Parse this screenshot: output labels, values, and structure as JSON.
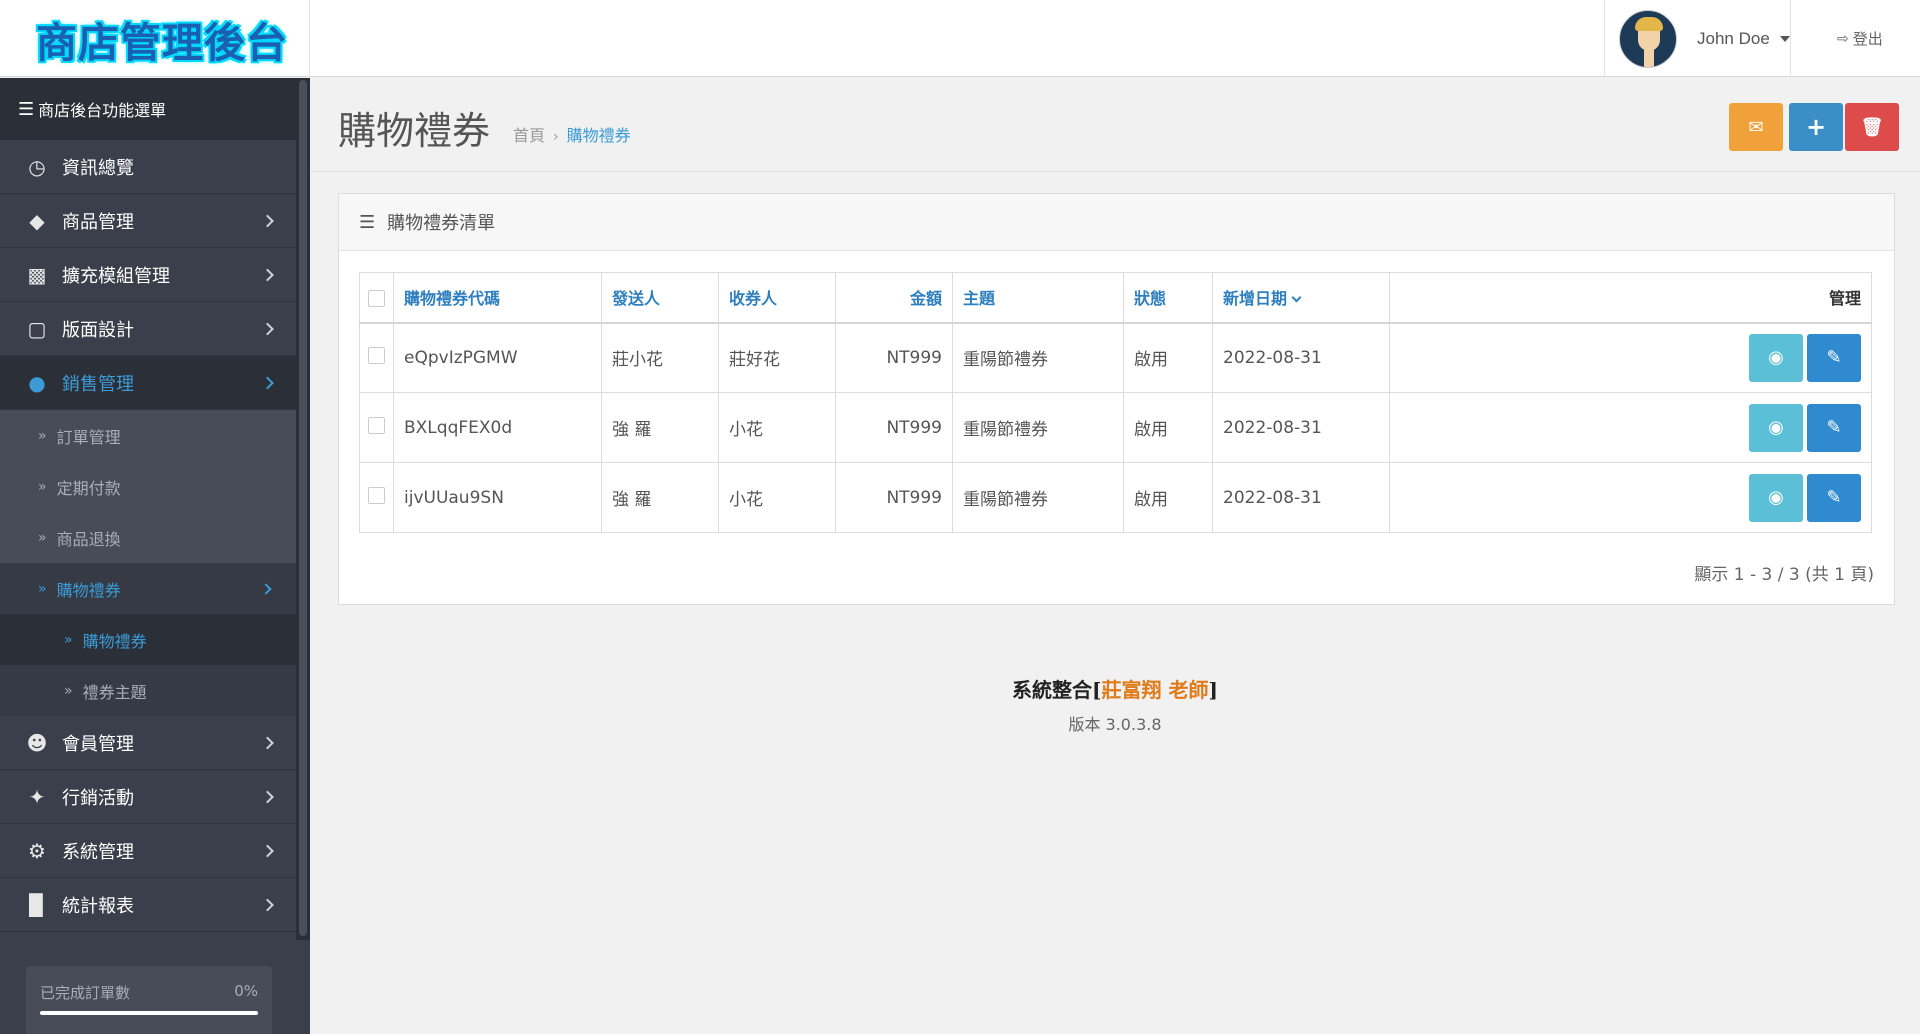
{
  "header": {
    "logo": "商店管理後台",
    "user_name": "John Doe",
    "logout_label": "登出"
  },
  "sidebar": {
    "title": "商店後台功能選單",
    "items": [
      {
        "label": "資訊總覽",
        "icon": "dashboard-icon",
        "has_children": false
      },
      {
        "label": "商品管理",
        "icon": "tags-icon",
        "has_children": true
      },
      {
        "label": "擴充模組管理",
        "icon": "puzzle-icon",
        "has_children": true
      },
      {
        "label": "版面設計",
        "icon": "monitor-icon",
        "has_children": true
      },
      {
        "label": "銷售管理",
        "icon": "cart-icon",
        "has_children": true,
        "active": true
      },
      {
        "label": "會員管理",
        "icon": "user-icon",
        "has_children": true
      },
      {
        "label": "行銷活動",
        "icon": "share-icon",
        "has_children": true
      },
      {
        "label": "系統管理",
        "icon": "gear-icon",
        "has_children": true
      },
      {
        "label": "統計報表",
        "icon": "bar-chart-icon",
        "has_children": true
      }
    ],
    "sales_submenu": [
      {
        "label": "訂單管理"
      },
      {
        "label": "定期付款"
      },
      {
        "label": "商品退換"
      },
      {
        "label": "購物禮券",
        "active": true
      }
    ],
    "coupon_submenu": [
      {
        "label": "購物禮券",
        "active": true
      },
      {
        "label": "禮券主題"
      }
    ],
    "stats": {
      "completed_label": "已完成訂單數",
      "completed_value": "0%",
      "completed_progress": 0
    }
  },
  "page": {
    "title": "購物禮券",
    "breadcrumb": {
      "home": "首頁",
      "current": "購物禮券"
    }
  },
  "panel": {
    "title": "購物禮券清單"
  },
  "table": {
    "columns": {
      "code": "購物禮券代碼",
      "sender": "發送人",
      "receiver": "收券人",
      "amount": "金額",
      "theme": "主題",
      "status": "狀態",
      "date": "新增日期",
      "manage": "管理"
    },
    "rows": [
      {
        "code": "eQpvIzPGMW",
        "sender": "莊小花",
        "receiver": "莊好花",
        "amount": "NT999",
        "theme": "重陽節禮券",
        "status": "啟用",
        "date": "2022-08-31"
      },
      {
        "code": "BXLqqFEX0d",
        "sender": "強 羅",
        "receiver": "小花",
        "amount": "NT999",
        "theme": "重陽節禮券",
        "status": "啟用",
        "date": "2022-08-31"
      },
      {
        "code": "ijvUUau9SN",
        "sender": "強 羅",
        "receiver": "小花",
        "amount": "NT999",
        "theme": "重陽節禮券",
        "status": "啟用",
        "date": "2022-08-31"
      }
    ],
    "pagination": "顯示 1 - 3 / 3 (共 1 頁)"
  },
  "footer": {
    "prefix": "系統整合[",
    "highlight": "莊富翔 老師",
    "suffix": "]",
    "version": "版本 3.0.3.8"
  }
}
